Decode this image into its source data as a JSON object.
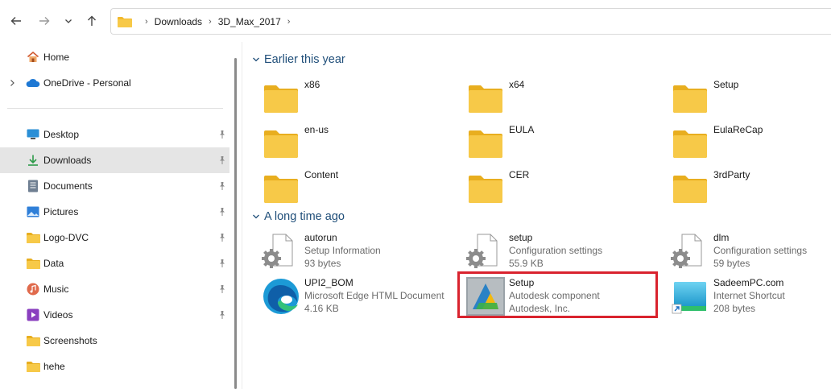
{
  "address_bar": {
    "crumbs": [
      "Downloads",
      "3D_Max_2017"
    ]
  },
  "sidebar": {
    "home": "Home",
    "onedrive": "OneDrive - Personal",
    "quick_access": [
      {
        "label": "Desktop",
        "icon": "desktop-icon"
      },
      {
        "label": "Downloads",
        "icon": "download-arrow-icon",
        "selected": true
      },
      {
        "label": "Documents",
        "icon": "documents-icon"
      },
      {
        "label": "Pictures",
        "icon": "pictures-icon"
      },
      {
        "label": "Logo-DVC",
        "icon": "folder-icon"
      },
      {
        "label": "Data",
        "icon": "folder-icon"
      },
      {
        "label": "Music",
        "icon": "music-icon"
      },
      {
        "label": "Videos",
        "icon": "videos-icon"
      },
      {
        "label": "Screenshots",
        "icon": "folder-icon"
      },
      {
        "label": "hehe",
        "icon": "folder-icon"
      }
    ]
  },
  "groups": [
    {
      "title": "Earlier this year",
      "items": [
        "x86",
        "x64",
        "Setup",
        "en-us",
        "EULA",
        "EulaReCap",
        "Content",
        "CER",
        "3rdParty"
      ]
    },
    {
      "title": "A long time ago",
      "items": [
        {
          "name": "autorun",
          "type": "Setup Information",
          "detail": "93 bytes",
          "icon": "settings-file-icon"
        },
        {
          "name": "setup",
          "type": "Configuration settings",
          "detail": "55.9 KB",
          "icon": "settings-file-icon"
        },
        {
          "name": "dlm",
          "type": "Configuration settings",
          "detail": "59 bytes",
          "icon": "settings-file-icon"
        },
        {
          "name": "UPI2_BOM",
          "type": "Microsoft Edge HTML Document",
          "detail": "4.16 KB",
          "icon": "edge-icon"
        },
        {
          "name": "Setup",
          "type": "Autodesk component",
          "detail": "Autodesk, Inc.",
          "icon": "autodesk-icon"
        },
        {
          "name": "SadeemPC.com",
          "type": "Internet Shortcut",
          "detail": "208 bytes",
          "icon": "internet-shortcut-icon"
        }
      ]
    }
  ],
  "colors": {
    "accent": "#1f4e79",
    "highlight_box": "#d9232e",
    "selected_row": "#e5e5e5",
    "folder": "#f7c948"
  }
}
